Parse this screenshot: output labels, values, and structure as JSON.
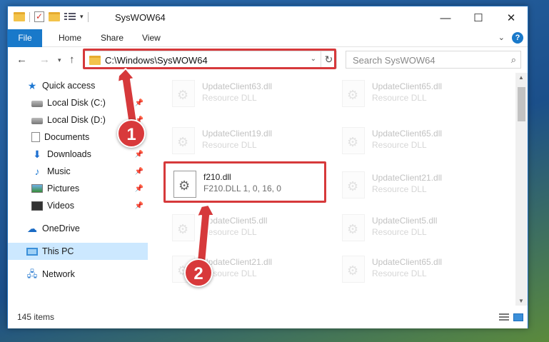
{
  "titlebar": {
    "title": "SysWOW64",
    "qat_dropdown": "▾",
    "minimize": "—",
    "maximize": "☐",
    "close": "✕"
  },
  "ribbon": {
    "tabs": [
      {
        "label": "File"
      },
      {
        "label": "Home"
      },
      {
        "label": "Share"
      },
      {
        "label": "View"
      }
    ],
    "expand": "⌄",
    "help": "?"
  },
  "nav": {
    "back": "←",
    "forward": "→",
    "recent": "▾",
    "up": "↑",
    "address": "C:\\Windows\\SysWOW64",
    "address_dropdown": "⌄",
    "refresh": "↻",
    "search_placeholder": "Search SysWOW64",
    "search_icon": "⌕"
  },
  "sidebar": {
    "items": [
      {
        "label": "Quick access",
        "icon": "star-icon"
      },
      {
        "label": "Local Disk (C:)",
        "icon": "drive-icon",
        "pinned": true
      },
      {
        "label": "Local Disk (D:)",
        "icon": "drive-icon",
        "pinned": true
      },
      {
        "label": "Documents",
        "icon": "documents-icon",
        "pinned": true
      },
      {
        "label": "Downloads",
        "icon": "download-icon",
        "pinned": true
      },
      {
        "label": "Music",
        "icon": "music-icon",
        "pinned": true
      },
      {
        "label": "Pictures",
        "icon": "pictures-icon",
        "pinned": true
      },
      {
        "label": "Videos",
        "icon": "videos-icon",
        "pinned": true
      },
      {
        "label": "OneDrive",
        "icon": "cloud-icon"
      },
      {
        "label": "This PC",
        "icon": "pc-icon",
        "selected": true
      },
      {
        "label": "Network",
        "icon": "network-icon"
      }
    ],
    "pin_glyph": "📌"
  },
  "files": [
    {
      "name": "UpdateClient63.dll",
      "desc": "Resource DLL"
    },
    {
      "name": "UpdateClient65.dll",
      "desc": "Resource DLL"
    },
    {
      "name": "UpdateClient19.dll",
      "desc": "Resource DLL"
    },
    {
      "name": "UpdateClient65.dll",
      "desc": "Resource DLL"
    },
    {
      "name": "f210.dll",
      "desc": "F210.DLL 1, 0, 16, 0"
    },
    {
      "name": "UpdateClient21.dll",
      "desc": "Resource DLL"
    },
    {
      "name": "UpdateClient5.dll",
      "desc": "Resource DLL"
    },
    {
      "name": "UpdateClient5.dll",
      "desc": "Resource DLL"
    },
    {
      "name": "UpdateClient21.dll",
      "desc": "Resource DLL"
    },
    {
      "name": "UpdateClient65.dll",
      "desc": "Resource DLL"
    }
  ],
  "status": {
    "item_count": "145 items"
  },
  "annotations": {
    "marker1": "1",
    "marker2": "2",
    "color": "#d6393b"
  },
  "colors": {
    "accent": "#1979ca",
    "selection": "#cce8ff"
  }
}
